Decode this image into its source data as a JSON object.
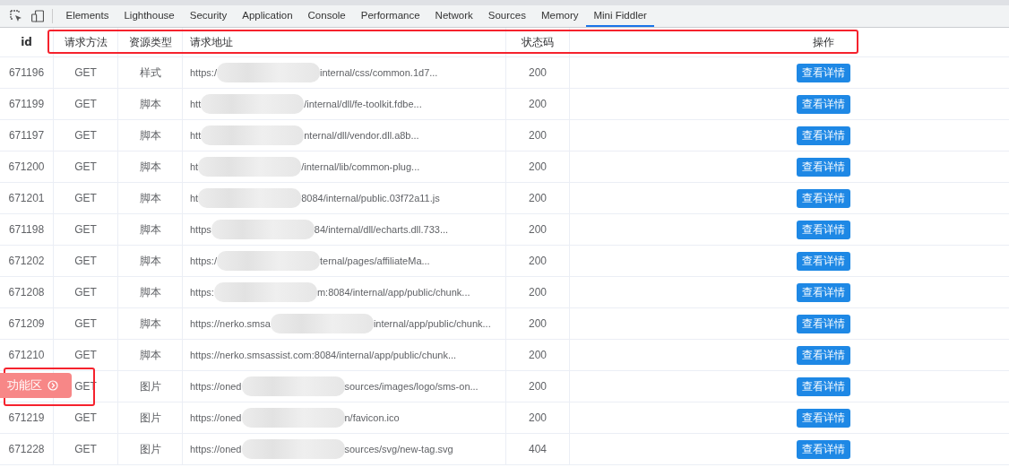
{
  "devtools_tabs": [
    {
      "label": "Elements",
      "selected": false
    },
    {
      "label": "Lighthouse",
      "selected": false
    },
    {
      "label": "Security",
      "selected": false
    },
    {
      "label": "Application",
      "selected": false
    },
    {
      "label": "Console",
      "selected": false
    },
    {
      "label": "Performance",
      "selected": false
    },
    {
      "label": "Network",
      "selected": false
    },
    {
      "label": "Sources",
      "selected": false
    },
    {
      "label": "Memory",
      "selected": false
    },
    {
      "label": "Mini Fiddler",
      "selected": true
    }
  ],
  "table": {
    "columns": [
      "id",
      "请求方法",
      "资源类型",
      "请求地址",
      "状态码",
      "操作"
    ],
    "rows": [
      {
        "id": "671196",
        "method": "GET",
        "type": "样式",
        "url_start": "https:/",
        "redacted": true,
        "url_end": "internal/css/common.1d7...",
        "status": "200",
        "action": "查看详情"
      },
      {
        "id": "671199",
        "method": "GET",
        "type": "脚本",
        "url_start": "htt",
        "redacted": true,
        "url_end": "/internal/dll/fe-toolkit.fdbe...",
        "status": "200",
        "action": "查看详情"
      },
      {
        "id": "671197",
        "method": "GET",
        "type": "脚本",
        "url_start": "htt",
        "redacted": true,
        "url_end": "nternal/dll/vendor.dll.a8b...",
        "status": "200",
        "action": "查看详情"
      },
      {
        "id": "671200",
        "method": "GET",
        "type": "脚本",
        "url_start": "ht",
        "redacted": true,
        "url_end": "/internal/lib/common-plug...",
        "status": "200",
        "action": "查看详情"
      },
      {
        "id": "671201",
        "method": "GET",
        "type": "脚本",
        "url_start": "ht",
        "redacted": true,
        "url_end": "8084/internal/public.03f72a11.js",
        "status": "200",
        "action": "查看详情"
      },
      {
        "id": "671198",
        "method": "GET",
        "type": "脚本",
        "url_start": "https",
        "redacted": true,
        "url_end": "84/internal/dll/echarts.dll.733...",
        "status": "200",
        "action": "查看详情"
      },
      {
        "id": "671202",
        "method": "GET",
        "type": "脚本",
        "url_start": "https:/",
        "redacted": true,
        "url_end": "ternal/pages/affiliateMa...",
        "status": "200",
        "action": "查看详情"
      },
      {
        "id": "671208",
        "method": "GET",
        "type": "脚本",
        "url_start": "https:",
        "redacted": true,
        "url_end": "m:8084/internal/app/public/chunk...",
        "status": "200",
        "action": "查看详情"
      },
      {
        "id": "671209",
        "method": "GET",
        "type": "脚本",
        "url_start": "https://nerko.smsa",
        "redacted": true,
        "url_end": "internal/app/public/chunk...",
        "status": "200",
        "action": "查看详情"
      },
      {
        "id": "671210",
        "method": "GET",
        "type": "脚本",
        "url_start": "https://nerko.smsassist.com:8084/internal/app/public/chunk...",
        "redacted": false,
        "status": "200",
        "action": "查看详情"
      },
      {
        "method": "GET",
        "type": "图片",
        "url_start": "https://oned",
        "redacted": true,
        "url_end": "sources/images/logo/sms-on...",
        "status": "200",
        "action": "查看详情"
      },
      {
        "id": "671219",
        "method": "GET",
        "type": "图片",
        "url_start": "https://oned",
        "redacted": true,
        "url_end": "n/favicon.ico",
        "status": "200",
        "action": "查看详情"
      },
      {
        "id": "671228",
        "method": "GET",
        "type": "图片",
        "url_start": "https://oned",
        "redacted": true,
        "url_end": "sources/svg/new-tag.svg",
        "status": "404",
        "action": "查看详情"
      }
    ]
  },
  "floating_button": {
    "label": "功能区"
  }
}
